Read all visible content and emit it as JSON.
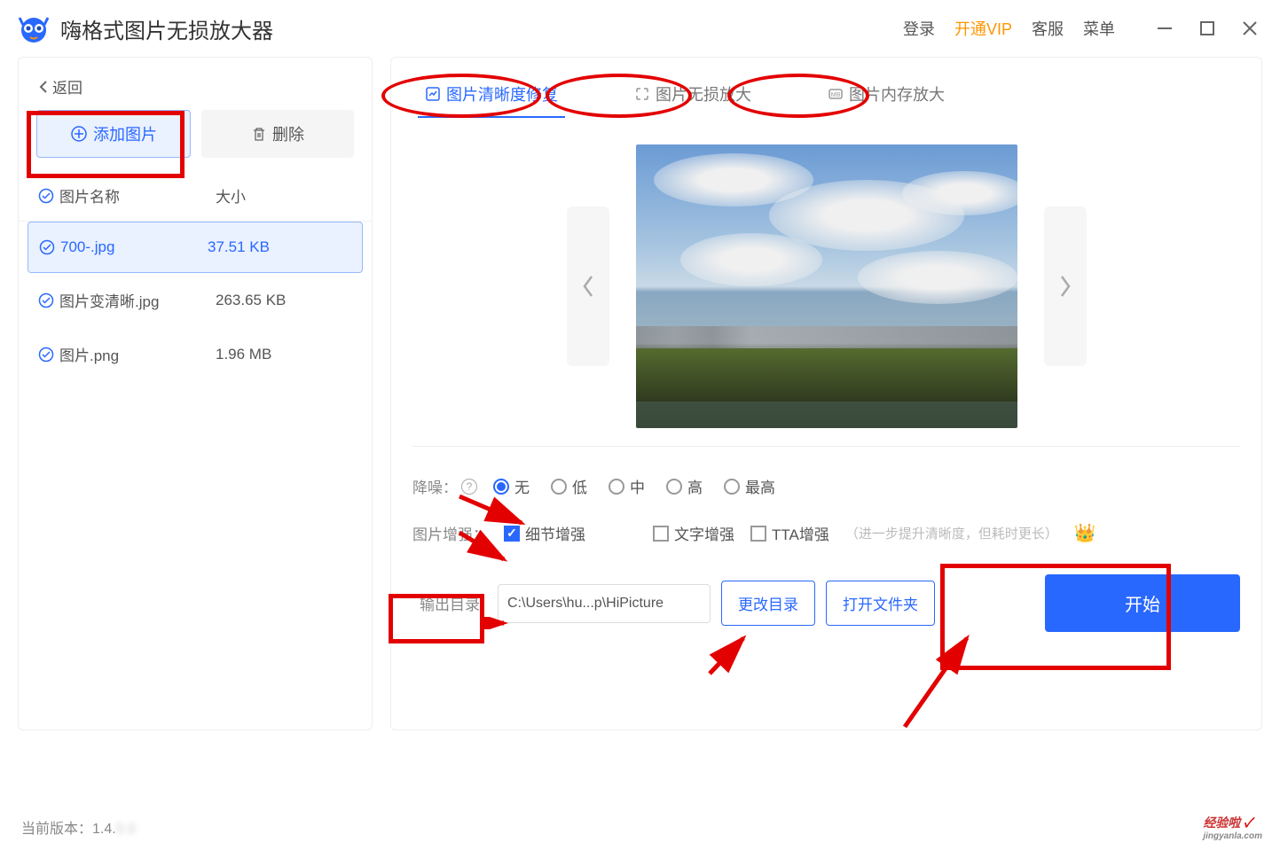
{
  "app": {
    "title": "嗨格式图片无损放大器"
  },
  "titlebar": {
    "login": "登录",
    "vip": "开通VIP",
    "support": "客服",
    "menu": "菜单"
  },
  "sidebar": {
    "back": "返回",
    "add_btn": "添加图片",
    "del_btn": "删除",
    "header_name": "图片名称",
    "header_size": "大小",
    "files": [
      {
        "name": "700-.jpg",
        "size": "37.51 KB",
        "selected": true
      },
      {
        "name": "图片变清晰.jpg",
        "size": "263.65 KB",
        "selected": false
      },
      {
        "name": "图片.png",
        "size": "1.96 MB",
        "selected": false
      }
    ]
  },
  "tabs": [
    {
      "label": "图片清晰度修复",
      "active": true
    },
    {
      "label": "图片无损放大",
      "active": false
    },
    {
      "label": "图片内存放大",
      "active": false
    }
  ],
  "noise": {
    "label": "降噪：",
    "options": [
      "无",
      "低",
      "中",
      "高",
      "最高"
    ],
    "selected": "无"
  },
  "enhance": {
    "label": "图片增强：",
    "detail": "细节增强",
    "text": "文字增强",
    "tta": "TTA增强",
    "hint": "（进一步提升清晰度，但耗时更长）"
  },
  "output": {
    "label": "输出目录",
    "path": "C:\\Users\\hu...p\\HiPicture",
    "change_dir": "更改目录",
    "open_folder": "打开文件夹",
    "start": "开始"
  },
  "footer": {
    "version_label": "当前版本：",
    "version": "1.4."
  },
  "watermark": {
    "main": "经验啦",
    "sub": "jingyanla.com"
  }
}
